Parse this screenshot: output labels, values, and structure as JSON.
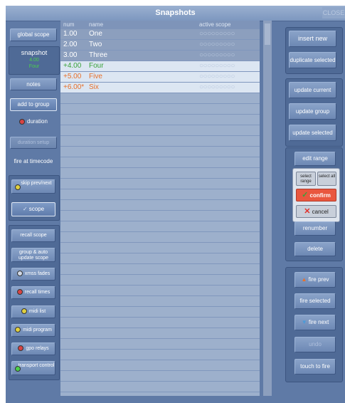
{
  "window": {
    "title": "Snapshots",
    "close_label": "CLOSE"
  },
  "left": {
    "global_scope": "global scope",
    "snapshot_label": "snapshot",
    "snapshot_num": "4.00",
    "snapshot_name": "Four",
    "notes": "notes",
    "add_to_group": "add to group",
    "duration": "duration",
    "duration_setup": "duration setup",
    "fire_at_timecode": "fire at timecode",
    "skip_prev_next": "skip prev/next",
    "scope": "scope",
    "recall_scope": "recall scope",
    "group_auto": "group & auto update scope",
    "xmss_fades": "xmss fades",
    "recall_times": "recall times",
    "midi_list": "midi list",
    "midi_program": "midi program",
    "gpo_relays": "gpo relays",
    "transport_control": "transport control"
  },
  "grid": {
    "headers": {
      "num": "num",
      "name": "name",
      "scope": "active scope"
    },
    "scope_marks": "○○○○○○○○○",
    "rows": [
      {
        "num": "1.00",
        "name": "One",
        "color": "#ffffff"
      },
      {
        "num": "2.00",
        "name": "Two",
        "color": "#ffffff"
      },
      {
        "num": "3.00",
        "name": "Three",
        "color": "#ffffff"
      },
      {
        "num": "+4.00",
        "name": "Four",
        "color": "#3aa23a"
      },
      {
        "num": "+5.00",
        "name": "Five",
        "color": "#e8702a"
      },
      {
        "num": "+6.00*",
        "name": "Six",
        "color": "#e8702a"
      }
    ]
  },
  "right": {
    "insert_new": "insert new",
    "duplicate_selected": "duplicate selected",
    "update_current": "update current",
    "update_group": "update group",
    "update_selected": "update selected",
    "edit_range": "edit range",
    "select_range": "select range",
    "select_all": "select all",
    "confirm": "confirm",
    "cancel": "cancel",
    "renumber": "renumber",
    "delete": "delete",
    "fire_prev": "fire prev",
    "fire_selected": "fire selected",
    "fire_next": "fire next",
    "undo": "undo",
    "touch_to_fire": "touch to fire"
  },
  "colors": {
    "panel": "#5f7aa6",
    "grid": "#9db0cc",
    "confirm": "#e9573f",
    "green": "#3aa23a"
  }
}
